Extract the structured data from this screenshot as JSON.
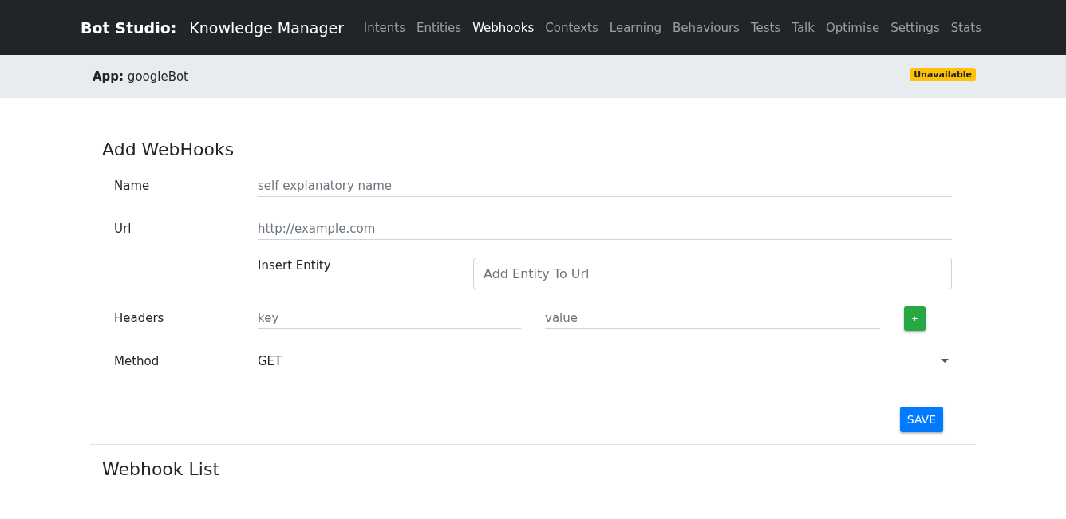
{
  "navbar": {
    "brand": "Bot Studio:",
    "subtitle": "Knowledge Manager",
    "items": [
      {
        "label": "Intents",
        "selected": false
      },
      {
        "label": "Entities",
        "selected": false
      },
      {
        "label": "Webhooks",
        "selected": true
      },
      {
        "label": "Contexts",
        "selected": false
      },
      {
        "label": "Learning",
        "selected": false
      },
      {
        "label": "Behaviours",
        "selected": false
      },
      {
        "label": "Tests",
        "selected": false
      },
      {
        "label": "Talk",
        "selected": false
      },
      {
        "label": "Optimise",
        "selected": false
      },
      {
        "label": "Settings",
        "selected": false
      },
      {
        "label": "Stats",
        "selected": false
      }
    ]
  },
  "app_bar": {
    "label": "App:",
    "name": "googleBot",
    "status": "Unavailable"
  },
  "form": {
    "title": "Add WebHooks",
    "name": {
      "label": "Name",
      "placeholder": "self explanatory name"
    },
    "url": {
      "label": "Url",
      "placeholder": "http://example.com"
    },
    "insert_entity": {
      "label": "Insert Entity",
      "placeholder": "Add Entity To Url"
    },
    "headers": {
      "label": "Headers",
      "key_placeholder": "key",
      "value_placeholder": "value",
      "add_button": "+"
    },
    "method": {
      "label": "Method",
      "value": "GET"
    },
    "save_button": "SAVE"
  },
  "list": {
    "title": "Webhook List"
  }
}
